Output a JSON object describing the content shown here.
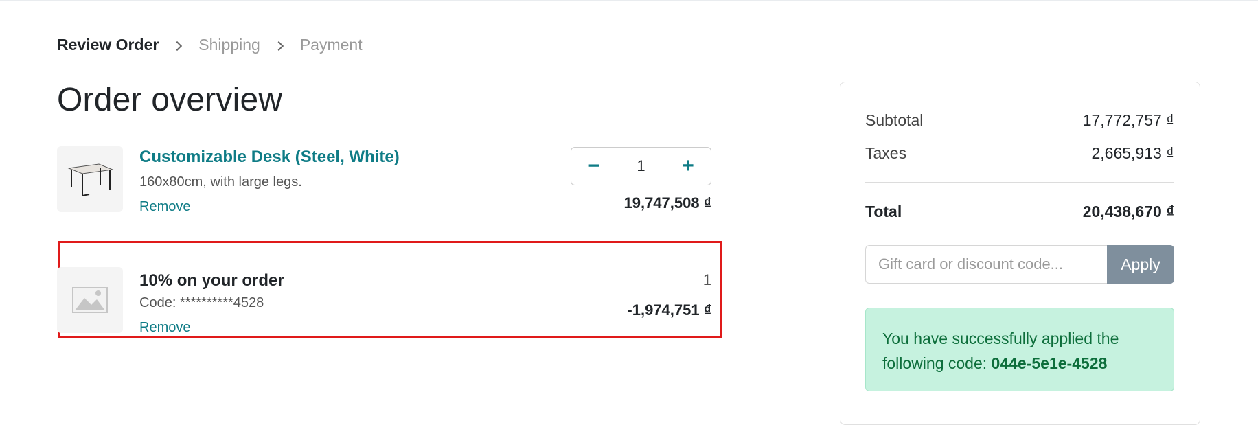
{
  "breadcrumb": {
    "steps": [
      "Review Order",
      "Shipping",
      "Payment"
    ]
  },
  "page_title": "Order overview",
  "cart": {
    "items": [
      {
        "name": "Customizable Desk (Steel, White)",
        "description": "160x80cm, with large legs.",
        "remove_label": "Remove",
        "quantity": "1",
        "price": "19,747,508 ₫",
        "decrement_icon": "minus-icon",
        "increment_icon": "plus-icon"
      },
      {
        "name": "10% on your order",
        "description": "Code: **********4528",
        "remove_label": "Remove",
        "quantity": "1",
        "price": "-1,974,751 ₫",
        "image_icon": "image-placeholder-icon"
      }
    ]
  },
  "summary": {
    "subtotal_label": "Subtotal",
    "subtotal_value": "17,772,757 ₫",
    "taxes_label": "Taxes",
    "taxes_value": "2,665,913 ₫",
    "total_label": "Total",
    "total_value": "20,438,670 ₫",
    "promo_placeholder": "Gift card or discount code...",
    "apply_label": "Apply",
    "success_text": "You have successfully applied the following code:",
    "success_code": "044e-5e1e-4528"
  },
  "colors": {
    "link": "#0f7c86",
    "highlight_border": "#e01a1a",
    "success_bg": "#c6f2df",
    "success_text": "#0d6e3b",
    "apply_button": "#7f8f9d"
  }
}
